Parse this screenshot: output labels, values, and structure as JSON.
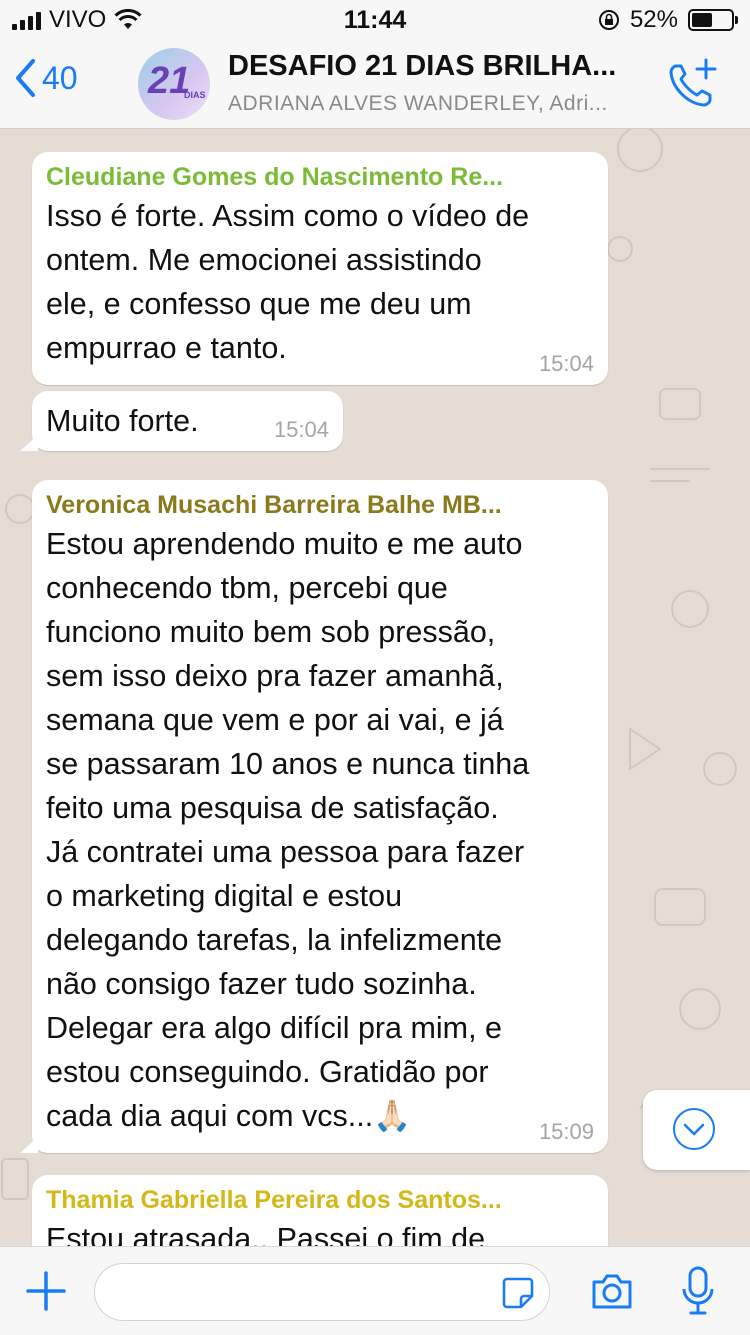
{
  "status_bar": {
    "carrier": "VIVO",
    "time": "11:44",
    "battery_percent": "52%",
    "battery_level": 0.52
  },
  "header": {
    "back_count": "40",
    "avatar_number": "21",
    "avatar_label": "DIAS",
    "title": "DESAFIO 21 DIAS BRILHA...",
    "subtitle": "ADRIANA ALVES WANDERLEY, Adri..."
  },
  "messages": [
    {
      "sender": "Cleudiane Gomes do Nascimento Re...",
      "sender_color": "#7cbb36",
      "text": "Isso é forte. Assim como o vídeo de\nontem. Me emocionei assistindo\nele, e confesso que me deu um\nempurrao e tanto.",
      "time": "15:04"
    },
    {
      "sender": "",
      "text": "Muito forte.",
      "time": "15:04"
    },
    {
      "sender": "Veronica Musachi Barreira Balhe MB...",
      "sender_color": "#8a7a1c",
      "text": "Estou aprendendo muito e me auto\nconhecendo tbm, percebi que\nfunciono muito bem sob pressão,\nsem isso deixo pra fazer amanhã,\nsemana que vem e por ai vai, e já\nse passaram 10 anos e nunca tinha\nfeito uma pesquisa de satisfação.\nJá contratei uma pessoa para fazer\no marketing digital e estou\ndelegando tarefas, la infelizmente\nnão consigo fazer tudo sozinha.\nDelegar era algo difícil pra mim, e\nestou conseguindo. Gratidão por\ncada dia aqui com vcs...🙏🏻",
      "time": "15:09"
    },
    {
      "sender": "Thamia Gabriella Pereira dos Santos...",
      "sender_color": "#d4b817",
      "text": "Estou atrasada.. Passei o fim de",
      "time": ""
    }
  ],
  "input": {
    "placeholder": ""
  },
  "colors": {
    "accent": "#1a7cf5",
    "chat_background": "#e5ddd4",
    "bubble": "#ffffff"
  }
}
